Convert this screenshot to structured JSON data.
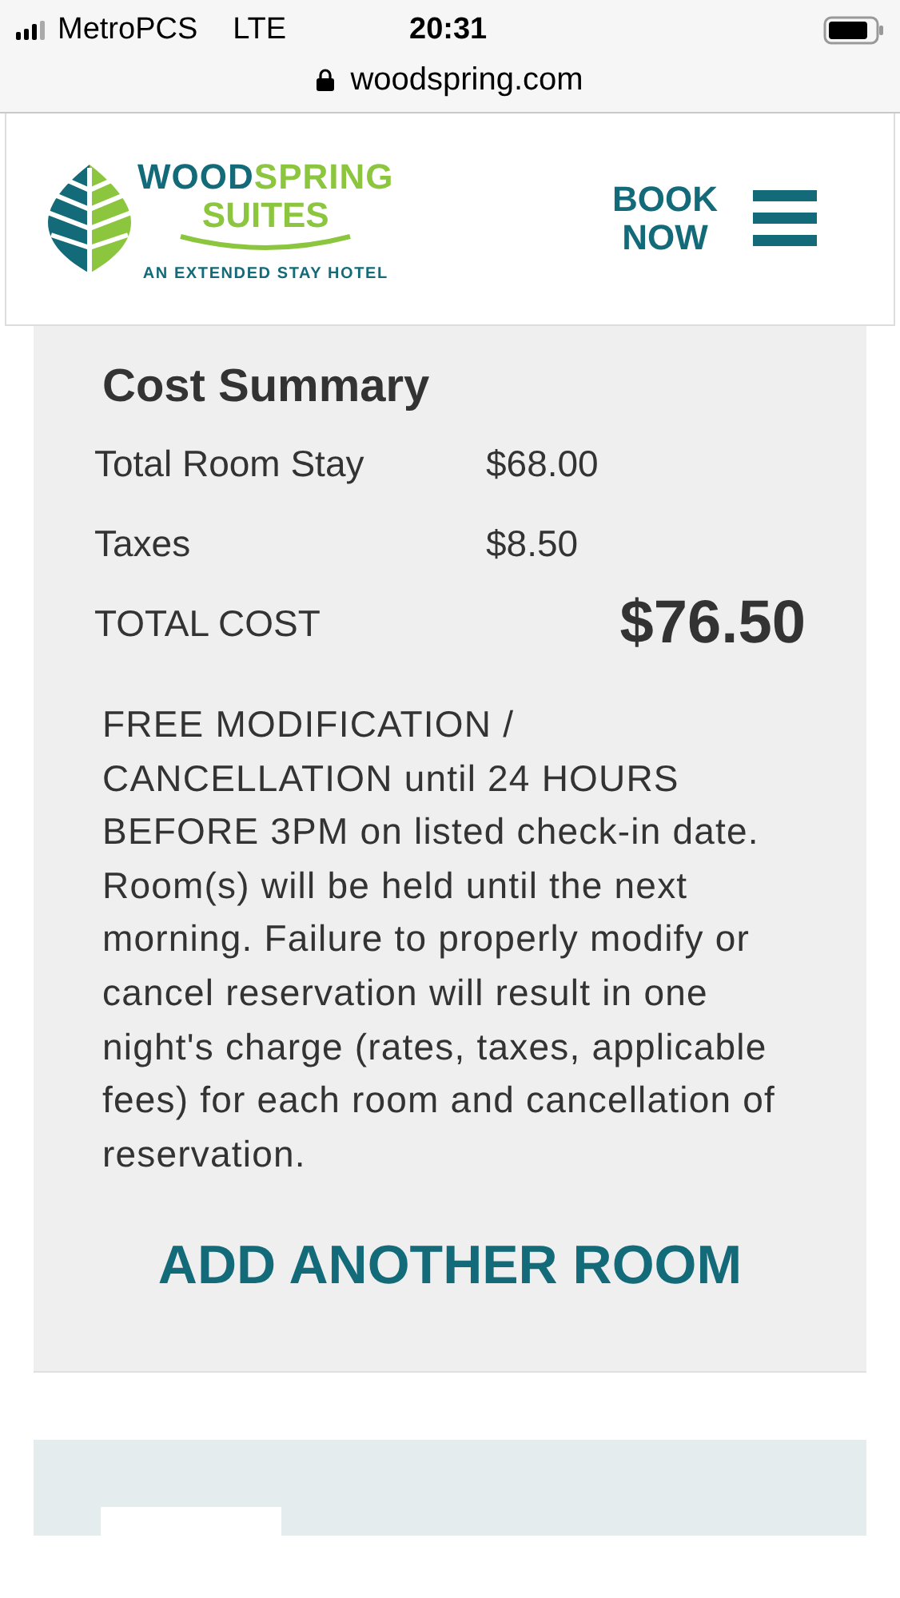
{
  "status_bar": {
    "carrier": "MetroPCS",
    "network": "LTE",
    "time": "20:31"
  },
  "address_bar": {
    "url": "woodspring.com"
  },
  "header": {
    "logo": {
      "brand_part_1": "WOOD",
      "brand_part_2": "SPRING",
      "line_2": "SUITES",
      "tagline": "AN EXTENDED STAY HOTEL"
    },
    "book_button": "BOOK NOW"
  },
  "cost_summary": {
    "title": "Cost Summary",
    "rows": [
      {
        "kind": "line",
        "label": "Total Room Stay",
        "amount": "$68.00"
      },
      {
        "kind": "line",
        "label": "Taxes",
        "amount": "$8.50"
      },
      {
        "kind": "total",
        "label": "TOTAL COST",
        "amount": "$76.50"
      }
    ],
    "policy": "FREE MODIFICATION / CANCELLATION until 24 HOURS BEFORE 3PM on listed check-in date. Room(s) will be held until the next morning. Failure to properly modify or cancel reservation will result in one night's charge (rates, taxes, applicable fees) for each room and cancellation of reservation.",
    "add_room_link": "ADD ANOTHER ROOM"
  }
}
